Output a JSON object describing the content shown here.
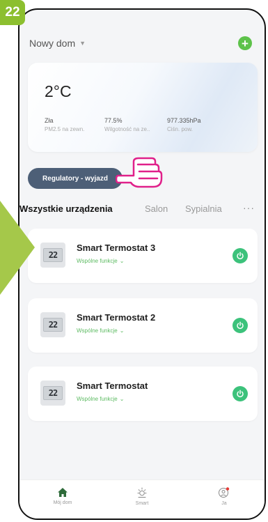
{
  "step": "22",
  "header": {
    "home_name": "Nowy dom",
    "add_icon": "plus-icon"
  },
  "weather": {
    "temperature": "2°C",
    "stats": [
      {
        "value": "Zła",
        "label": "PM2.5 na zewn."
      },
      {
        "value": "77.5%",
        "label": "Wilgotność na ze.."
      },
      {
        "value": "977.335hPa",
        "label": "Ciśn. pow."
      }
    ]
  },
  "scene": {
    "label": "Regulatory - wyjazd"
  },
  "tabs": {
    "items": [
      "Wszystkie urządzenia",
      "Salon",
      "Sypialnia"
    ],
    "more": "···"
  },
  "devices": [
    {
      "name": "Smart Termostat 3",
      "sub": "Wspólne funkcje",
      "display": "22"
    },
    {
      "name": "Smart Termostat 2",
      "sub": "Wspólne funkcje",
      "display": "22"
    },
    {
      "name": "Smart Termostat",
      "sub": "Wspólne funkcje",
      "display": "22"
    }
  ],
  "nav": {
    "items": [
      {
        "label": "Mój dom",
        "icon": "home-icon"
      },
      {
        "label": "Smart",
        "icon": "sun-icon"
      },
      {
        "label": "Ja",
        "icon": "profile-icon"
      }
    ]
  },
  "colors": {
    "accent": "#5dc24a",
    "scene": "#4d5f77",
    "power": "#3cc27b",
    "step_green": "#8cbf2f",
    "hand": "#e0208a"
  }
}
